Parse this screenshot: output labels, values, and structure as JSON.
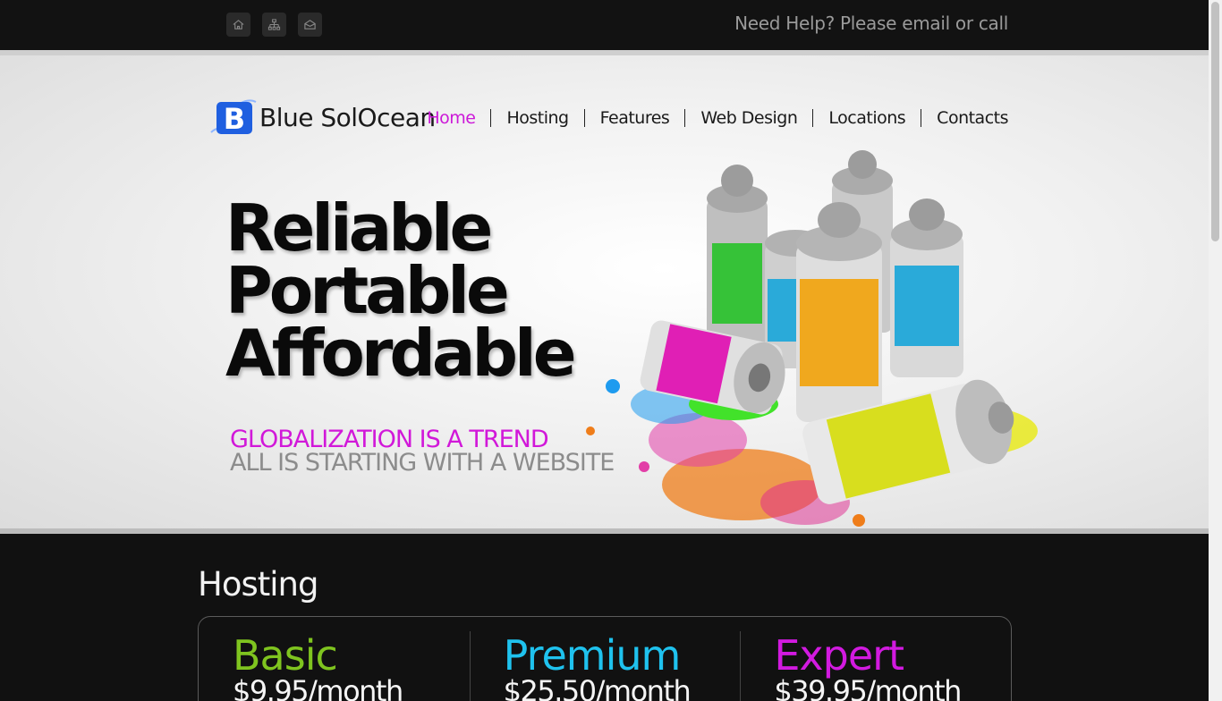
{
  "topbar": {
    "icons": [
      "home-icon",
      "sitemap-icon",
      "mail-icon"
    ],
    "help_text": "Need Help? Please email or call"
  },
  "brand": {
    "logo_letter": "B",
    "name": "Blue SolOcean",
    "logo_color": "#1f5fe0"
  },
  "nav": {
    "items": [
      "Home",
      "Hosting",
      "Features",
      "Web Design",
      "Locations",
      "Contacts"
    ],
    "active": "Home",
    "active_color": "#cc19d8"
  },
  "hero": {
    "headline": [
      "Reliable",
      "Portable",
      "Affordable"
    ],
    "tagline_primary": "GLOBALIZATION IS A TREND",
    "tagline_secondary": "ALL IS STARTING WITH A WEBSITE"
  },
  "hosting": {
    "title": "Hosting",
    "plans": [
      {
        "name": "Basic",
        "price": "$9.95/month",
        "color": "#7fc41f"
      },
      {
        "name": "Premium",
        "price": "$25.50/month",
        "color": "#1fc2ee"
      },
      {
        "name": "Expert",
        "price": "$39.95/month",
        "color": "#d21ae0"
      }
    ]
  }
}
